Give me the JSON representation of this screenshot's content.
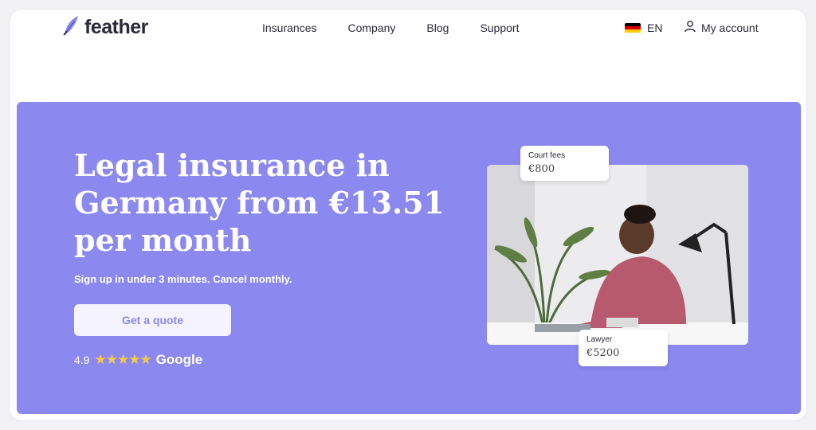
{
  "brand": {
    "name": "feather"
  },
  "nav": {
    "items": [
      "Insurances",
      "Company",
      "Blog",
      "Support"
    ]
  },
  "language": {
    "code": "EN"
  },
  "account": {
    "label": "My account"
  },
  "hero": {
    "title": "Legal insurance in Germany from €13.51 per month",
    "subtitle": "Sign up in under 3 minutes. Cancel monthly.",
    "cta": "Get a quote",
    "rating": "4.9",
    "stars": "★★★★★",
    "rating_source": "Google"
  },
  "cards": {
    "court": {
      "label": "Court fees",
      "value": "€800"
    },
    "lawyer": {
      "label": "Lawyer",
      "value": "€5200"
    }
  },
  "colors": {
    "hero_bg": "#8b89f0",
    "star": "#f7c948",
    "text_dark": "#2b2a3a"
  }
}
